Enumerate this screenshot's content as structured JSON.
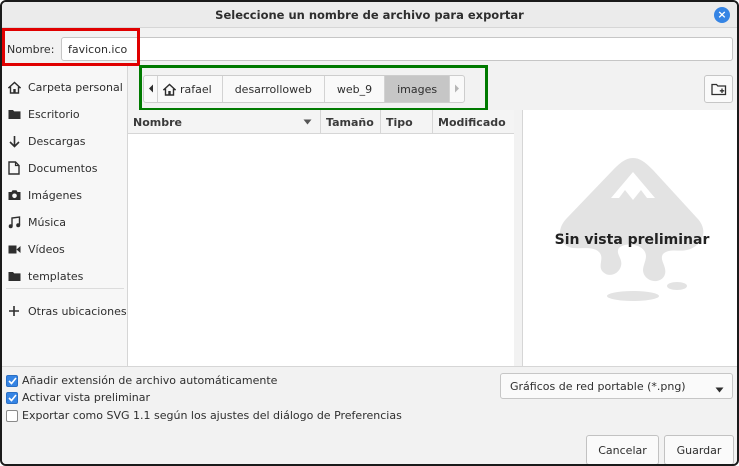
{
  "window": {
    "title": "Seleccione un nombre de archivo para exportar",
    "close_glyph": "×"
  },
  "name_field": {
    "label": "Nombre:",
    "value": "favicon.ico"
  },
  "sidebar": {
    "items": [
      {
        "label": "Carpeta personal",
        "icon": "home-icon"
      },
      {
        "label": "Escritorio",
        "icon": "folder-icon"
      },
      {
        "label": "Descargas",
        "icon": "download-icon"
      },
      {
        "label": "Documentos",
        "icon": "document-icon"
      },
      {
        "label": "Imágenes",
        "icon": "camera-icon"
      },
      {
        "label": "Música",
        "icon": "music-icon"
      },
      {
        "label": "Vídeos",
        "icon": "video-icon"
      },
      {
        "label": "templates",
        "icon": "folder-icon"
      },
      {
        "label": "Otras ubicaciones",
        "icon": "plus-icon"
      }
    ]
  },
  "pathbar": {
    "crumbs": [
      "rafael",
      "desarrolloweb",
      "web_9",
      "images"
    ],
    "active": "images"
  },
  "file_list": {
    "columns": [
      "Nombre",
      "Tamaño",
      "Tipo",
      "Modificado"
    ]
  },
  "preview": {
    "text": "Sin vista preliminar"
  },
  "options": {
    "auto_extension": {
      "label": "Añadir extensión de archivo automáticamente",
      "checked": true
    },
    "enable_preview": {
      "label": "Activar vista preliminar",
      "checked": true
    },
    "export_svg11": {
      "label": "Exportar como SVG 1.1 según los ajustes del diálogo de Preferencias",
      "checked": false
    }
  },
  "file_type_filter": {
    "selected": "Gráficos de red portable (*.png)"
  },
  "buttons": {
    "cancel": "Cancelar",
    "save": "Guardar"
  },
  "colors": {
    "accent": "#3584e4",
    "highlight_red": "#e00000",
    "highlight_green": "#007a00"
  }
}
